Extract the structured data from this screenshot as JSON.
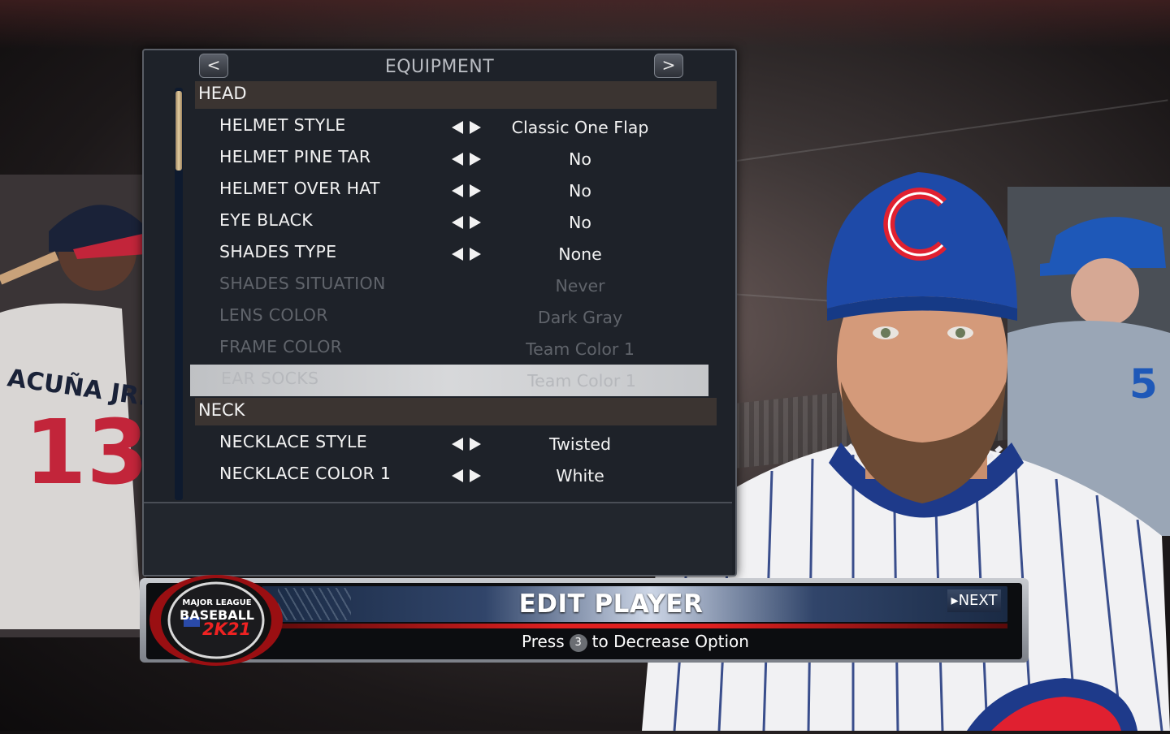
{
  "panel": {
    "title": "EQUIPMENT",
    "prev_label": "<",
    "next_label": ">"
  },
  "sections": [
    {
      "label": "HEAD",
      "options": [
        {
          "label": "HELMET STYLE",
          "value": "Classic One Flap",
          "state": "enabled"
        },
        {
          "label": "HELMET PINE TAR",
          "value": "No",
          "state": "enabled"
        },
        {
          "label": "HELMET OVER HAT",
          "value": "No",
          "state": "enabled"
        },
        {
          "label": "EYE BLACK",
          "value": "No",
          "state": "enabled"
        },
        {
          "label": "SHADES TYPE",
          "value": "None",
          "state": "enabled"
        },
        {
          "label": "SHADES SITUATION",
          "value": "Never",
          "state": "disabled"
        },
        {
          "label": "LENS COLOR",
          "value": "Dark Gray",
          "state": "disabled"
        },
        {
          "label": "FRAME COLOR",
          "value": "Team Color 1",
          "state": "disabled"
        },
        {
          "label": "EAR SOCKS",
          "value": "Team Color 1",
          "state": "selected-disabled"
        }
      ]
    },
    {
      "label": "NECK",
      "options": [
        {
          "label": "NECKLACE STYLE",
          "value": "Twisted",
          "state": "enabled"
        },
        {
          "label": "NECKLACE COLOR 1",
          "value": "White",
          "state": "enabled"
        }
      ]
    }
  ],
  "bottom_bar": {
    "title": "EDIT PLAYER",
    "next_label": "NEXT",
    "hint_prefix": "Press",
    "hint_key": "3",
    "hint_suffix": "to Decrease Option"
  },
  "logo": {
    "line1": "MAJOR LEAGUE",
    "line2": "BASEBALL",
    "line3": "2K21"
  },
  "colors": {
    "accent_red": "#e02020",
    "panel_bg": "#1e2229",
    "section_bg": "#3b3431",
    "scroll_thumb": "#e2cc9f"
  },
  "icons": [
    "chevron-left-icon",
    "chevron-right-icon",
    "arrow-left-icon",
    "arrow-right-icon",
    "mlb-logo-icon"
  ],
  "scroll_position": 0.0
}
